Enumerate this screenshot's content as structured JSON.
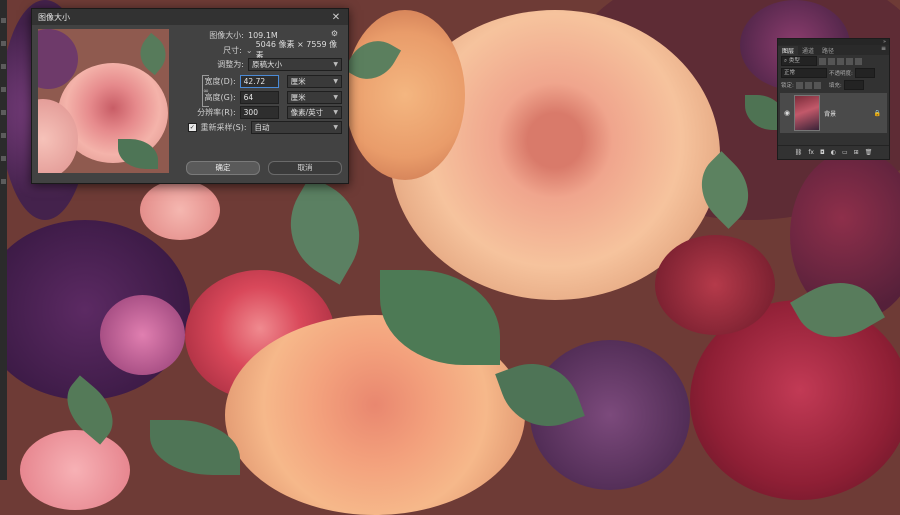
{
  "dialog": {
    "title": "图像大小",
    "close_glyph": "✕",
    "image_size_label": "图像大小:",
    "image_size_value": "109.1M",
    "dimensions_label": "尺寸:",
    "dimensions_value": "5046 像素 × 7559 像素",
    "fit_to_label": "调整为:",
    "fit_to_value": "原稿大小",
    "width_label": "宽度(D):",
    "width_value": "42.72",
    "width_unit": "厘米",
    "height_label": "高度(G):",
    "height_value": "64",
    "height_unit": "厘米",
    "resolution_label": "分辨率(R):",
    "resolution_value": "300",
    "resolution_unit": "像素/英寸",
    "resample_label": "重新采样(S):",
    "resample_value": "自动",
    "ok_label": "确定",
    "cancel_label": "取消",
    "icons": {
      "gear": "gear-icon",
      "link": "chain-link-icon",
      "check": "checkmark-icon"
    }
  },
  "layers_panel": {
    "tabs": [
      "图层",
      "通道",
      "路径"
    ],
    "active_tab": "图层",
    "search_placeholder": "类型",
    "blend_mode": "正常",
    "opacity_label": "不透明度:",
    "lock_label": "锁定:",
    "fill_label": "填充:",
    "layer_name": "背景",
    "icons": [
      "link-icon",
      "fx-icon",
      "mask-icon",
      "adjustment-icon",
      "folder-icon",
      "new-layer-icon",
      "trash-icon"
    ]
  },
  "colors": {
    "dialog_bg": "#424242",
    "panel_bg": "#323232",
    "field_bg": "#2e2e2e",
    "accent_rose": "#e98c7e",
    "accent_peach": "#f2a97a"
  }
}
